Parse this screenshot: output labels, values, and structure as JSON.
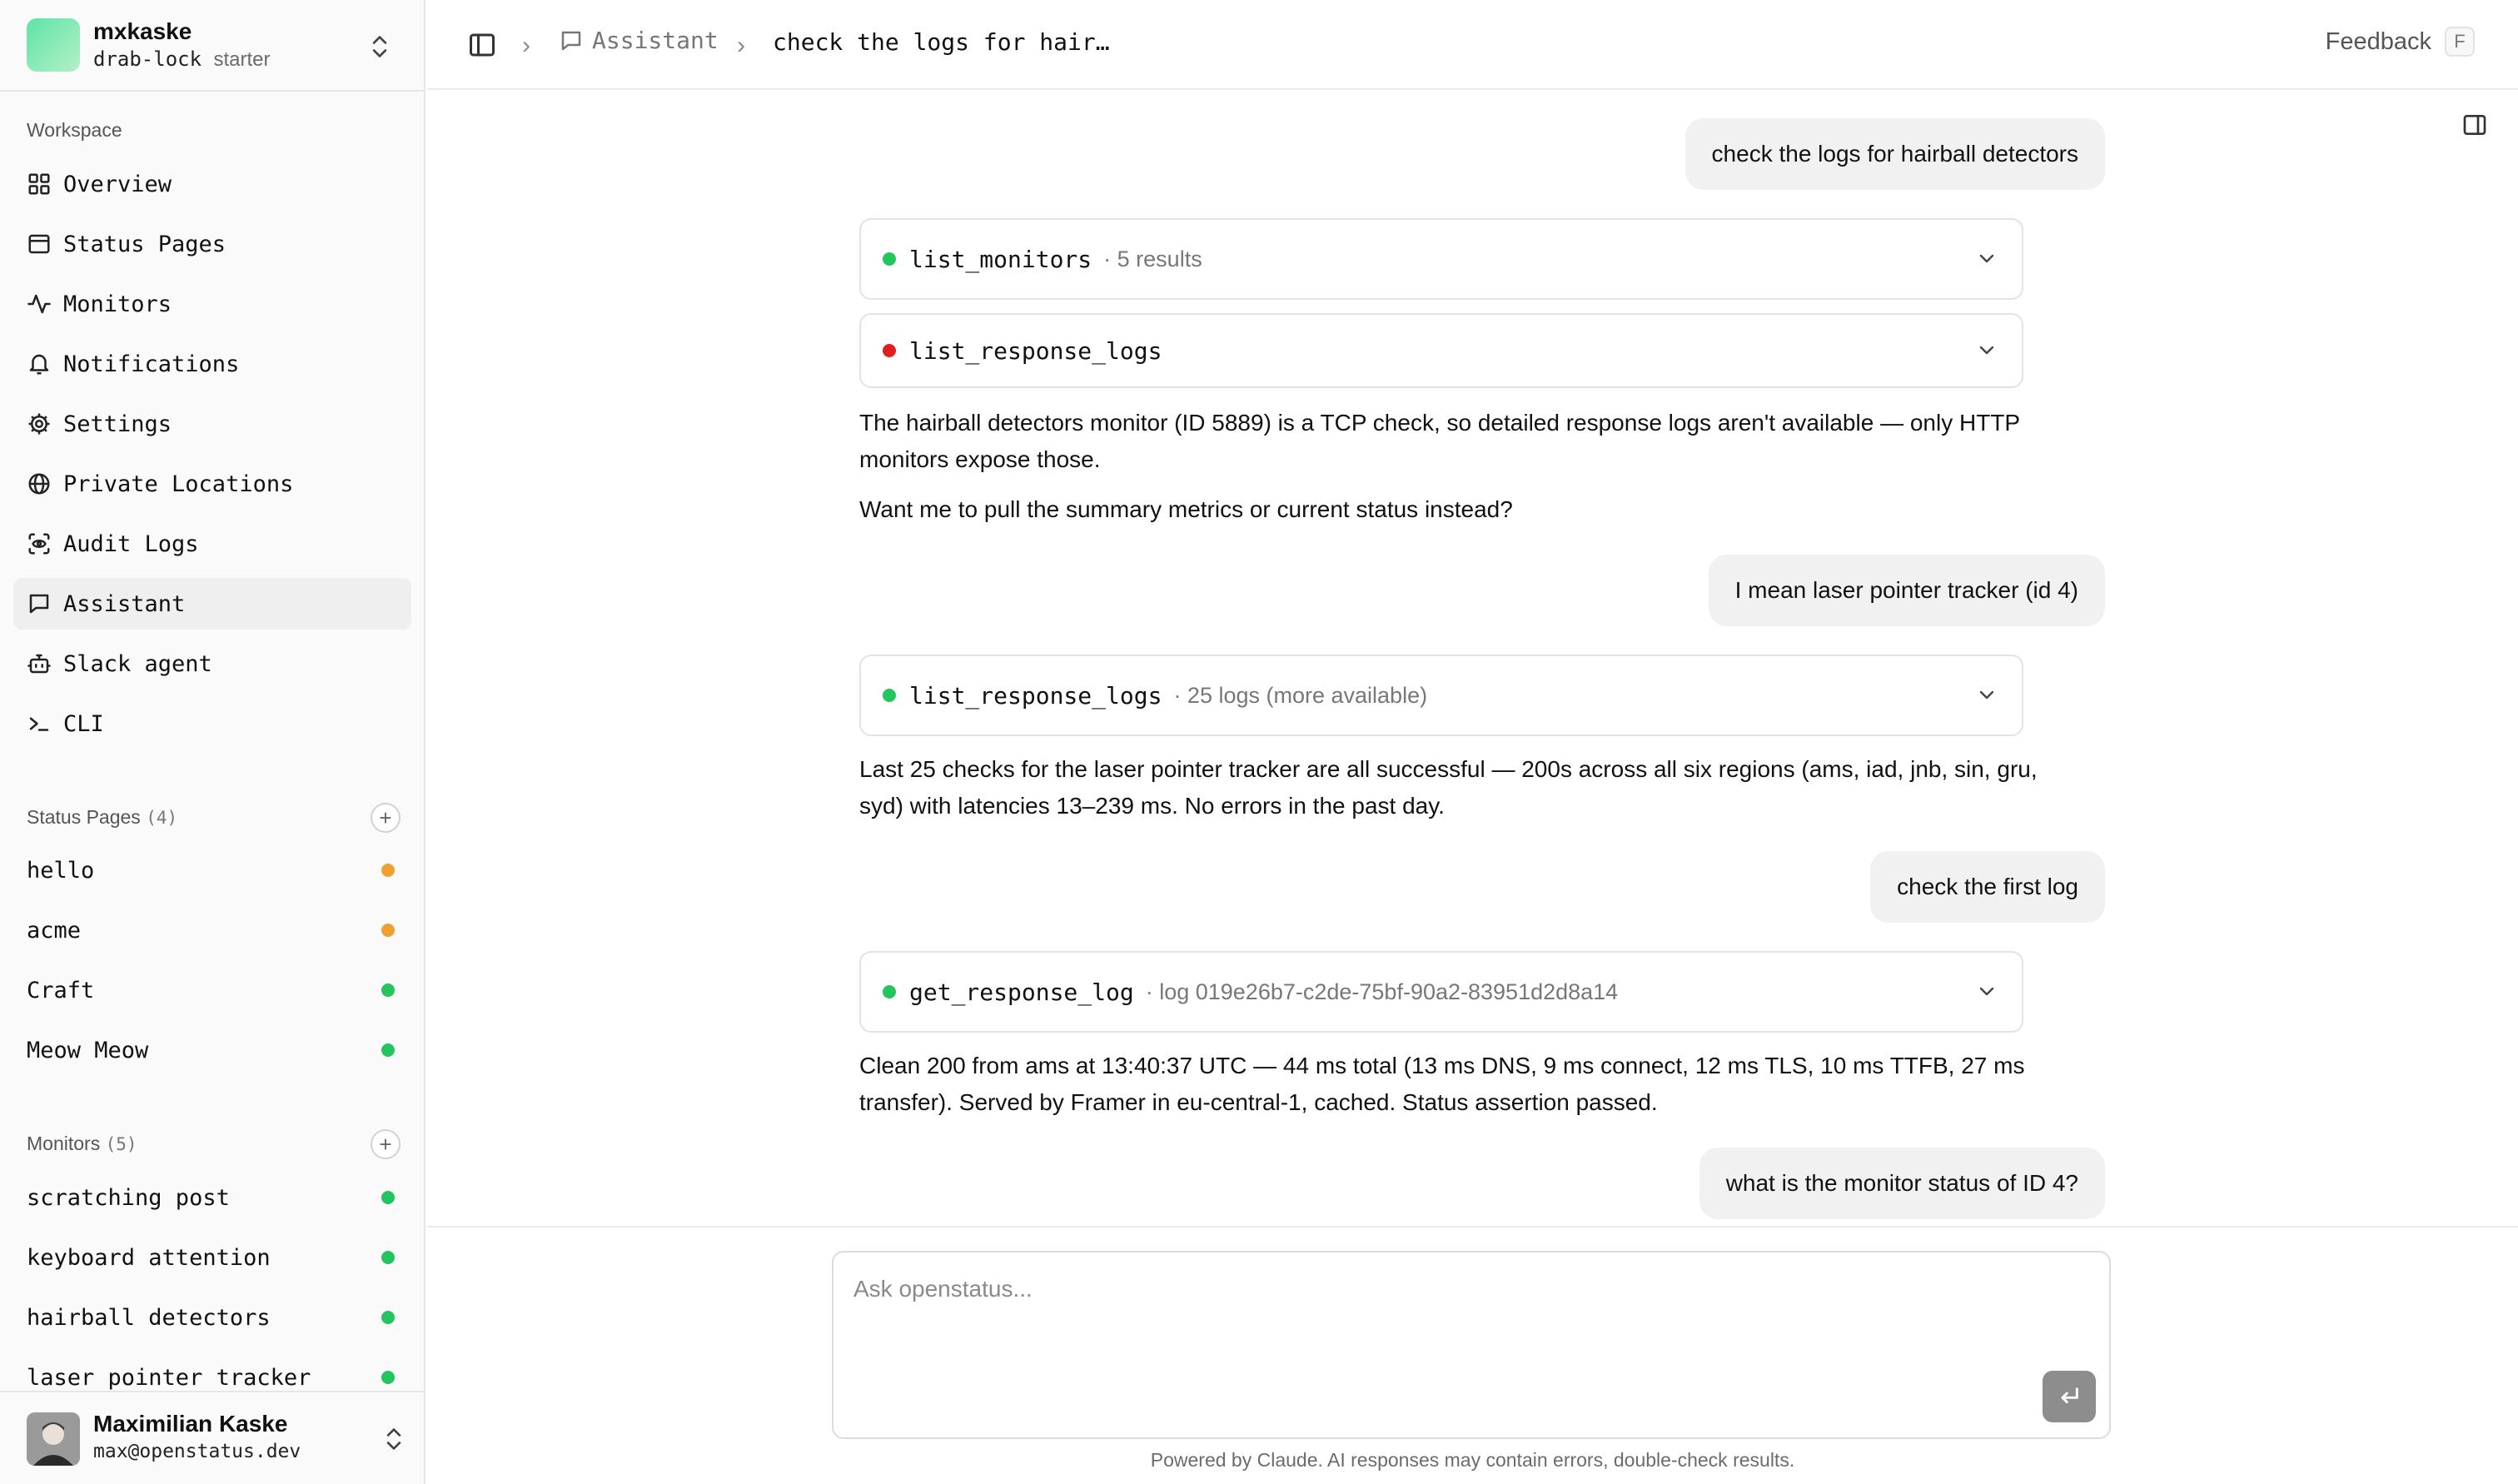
{
  "workspace": {
    "name": "mxkaske",
    "slug": "drab-lock",
    "plan": "starter"
  },
  "sidebar": {
    "workspace_label": "Workspace",
    "nav": [
      {
        "label": "Overview",
        "icon": "grid-icon"
      },
      {
        "label": "Status Pages",
        "icon": "window-icon"
      },
      {
        "label": "Monitors",
        "icon": "activity-icon"
      },
      {
        "label": "Notifications",
        "icon": "bell-icon"
      },
      {
        "label": "Settings",
        "icon": "gear-icon"
      },
      {
        "label": "Private Locations",
        "icon": "globe-icon"
      },
      {
        "label": "Audit Logs",
        "icon": "scan-eye-icon"
      },
      {
        "label": "Assistant",
        "icon": "message-icon",
        "active": true
      },
      {
        "label": "Slack agent",
        "icon": "bot-icon"
      },
      {
        "label": "CLI",
        "icon": "terminal-icon"
      }
    ],
    "status_pages": {
      "label": "Status Pages",
      "count": "(4)",
      "items": [
        {
          "label": "hello",
          "status": "degraded"
        },
        {
          "label": "acme",
          "status": "degraded"
        },
        {
          "label": "Craft",
          "status": "operational"
        },
        {
          "label": "Meow Meow",
          "status": "operational"
        }
      ]
    },
    "monitors": {
      "label": "Monitors",
      "count": "(5)",
      "items": [
        {
          "label": "scratching post",
          "status": "operational"
        },
        {
          "label": "keyboard attention",
          "status": "operational"
        },
        {
          "label": "hairball detectors",
          "status": "operational"
        },
        {
          "label": "laser pointer tracker",
          "status": "operational"
        }
      ]
    },
    "user": {
      "name": "Maximilian Kaske",
      "email": "max@openstatus.dev"
    }
  },
  "topbar": {
    "breadcrumb_section": "Assistant",
    "breadcrumb_current": "check the logs for hair…",
    "feedback_label": "Feedback",
    "feedback_shortcut": "F"
  },
  "chat": {
    "user_msg_1": "check the logs for hairball detectors",
    "tool_1": {
      "name": "list_monitors",
      "meta": "· 5 results",
      "status": "success"
    },
    "tool_2": {
      "name": "list_response_logs",
      "meta": "",
      "status": "error"
    },
    "reply_1a": "The hairball detectors monitor (ID 5889) is a TCP check, so detailed response logs aren't available — only HTTP monitors expose those.",
    "reply_1b": "Want me to pull the summary metrics or current status instead?",
    "user_msg_2": "I mean laser pointer tracker (id 4)",
    "tool_3": {
      "name": "list_response_logs",
      "meta": "· 25 logs (more available)",
      "status": "success"
    },
    "reply_2": "Last 25 checks for the laser pointer tracker are all successful — 200s across all six regions (ams, iad, jnb, sin, gru, syd) with latencies 13–239 ms. No errors in the past day.",
    "user_msg_3": "check the first log",
    "tool_4": {
      "name": "get_response_log",
      "meta": "· log 019e26b7-c2de-75bf-90a2-83951d2d8a14",
      "status": "success"
    },
    "reply_3": "Clean 200 from ams at 13:40:37 UTC — 44 ms total (13 ms DNS, 9 ms connect, 12 ms TLS, 10 ms TTFB, 27 ms transfer). Served by Framer in eu-central-1, cached. Status assertion passed.",
    "user_msg_4": "what is the monitor status of ID 4?"
  },
  "composer": {
    "placeholder": "Ask openstatus...",
    "disclaimer": "Powered by Claude. AI responses may contain errors, double-check results."
  },
  "colors": {
    "operational": "#22c55e",
    "degraded": "#f0a030",
    "error": "#e11d1d",
    "send_button": "#8d8d8d"
  }
}
